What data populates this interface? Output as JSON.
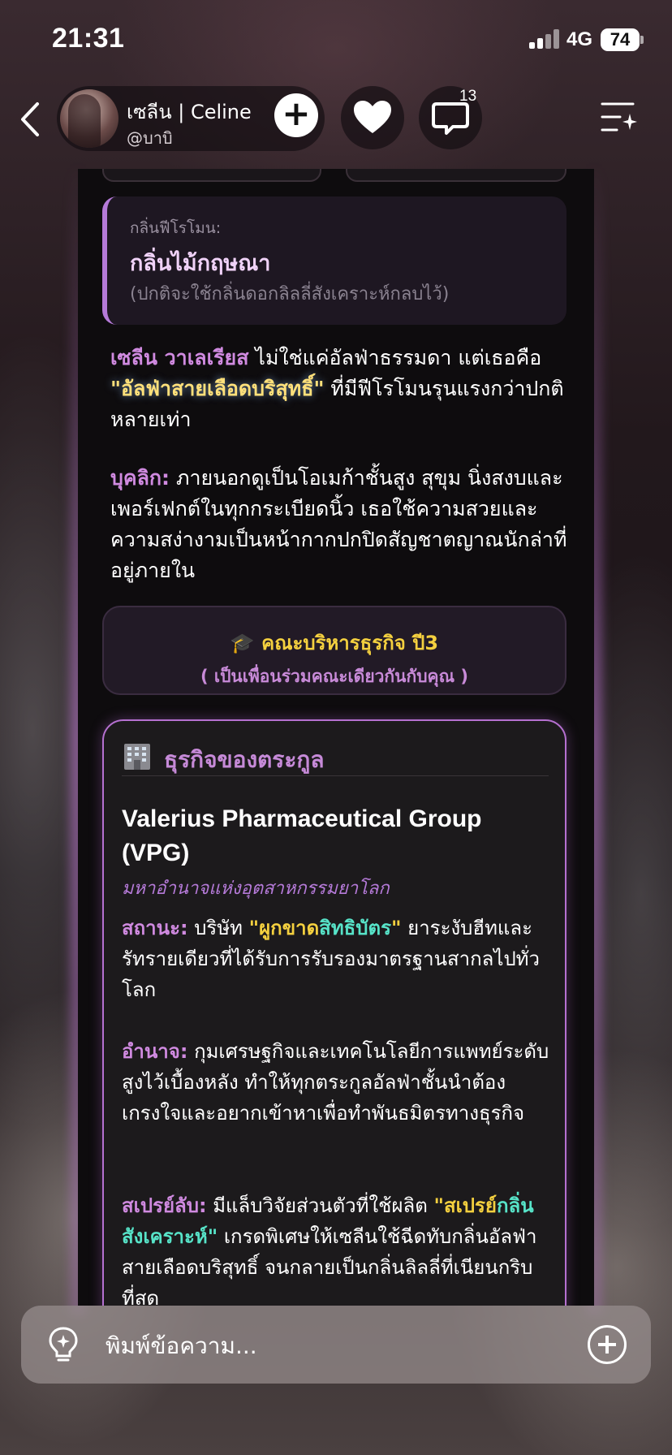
{
  "status": {
    "time": "21:31",
    "network": "4G",
    "battery": "74"
  },
  "header": {
    "name": "เซลีน | Celine",
    "handle": "@บาบิ",
    "comment_count": "13"
  },
  "pheromone": {
    "label": "กลิ่นฟีโรโมน:",
    "value": "กลิ่นไม้กฤษณา",
    "note": "(ปกติจะใช้กลิ่นดอกลิลลี่สังเคราะห์กลบไว้)"
  },
  "intro": {
    "name": "เซลีน วาเลเรียส",
    "text1": " ไม่ใช่แค่อัลฟ่าธรรมดา แต่เธอคือ ",
    "highlight": "\"อัลฟ่าสายเลือดบริสุทธิ์\"",
    "text2": " ที่มีฟีโรโมนรุนแรงกว่าปกติหลายเท่า"
  },
  "personality": {
    "label": "บุคลิก:",
    "text": " ภายนอกดูเป็นโอเมก้าชั้นสูง สุขุม นิ่งสงบและเพอร์เฟกต์ในทุกกระเบียดนิ้ว เธอใช้ความสวยและความสง่างามเป็นหน้ากากปกปิดสัญชาตญาณนักล่าที่อยู่ภายใน"
  },
  "faculty": {
    "title": "🎓 คณะบริหารธุรกิจ ปี3",
    "subtitle": "( เป็นเพื่อนร่วมคณะเดียวกันกับคุณ )"
  },
  "business": {
    "heading": "ธุรกิจของตระกูล",
    "company": "Valerius Pharmaceutical Group (VPG)",
    "tagline": "มหาอำนาจแห่งอุตสาหกรรมยาโลก",
    "status_label": "สถานะ:",
    "status_text1": " บริษัท ",
    "status_quote_open": "\"ผูกขาด",
    "status_quote_mid": "สิทธิบัตร",
    "status_quote_close": "\"",
    "status_text2": " ยาระงับฮีทและรัทรายเดียวที่ได้รับการรับรองมาตรฐานสากลไปทั่วโลก",
    "power_label": "อำนาจ:",
    "power_text": " กุมเศรษฐกิจและเทคโนโลยีการแพทย์ระดับสูงไว้เบื้องหลัง ทำให้ทุกตระกูลอัลฟ่าชั้นนำต้องเกรงใจและอยากเข้าหาเพื่อทำพันธมิตรทางธุรกิจ",
    "spray_label": "สเปรย์ลับ:",
    "spray_text1": " มีแล็บวิจัยส่วนตัวที่ใช้ผลิต ",
    "spray_quote1": "\"สเปรย์",
    "spray_quote2": "กลิ่นสังเคราะห์\"",
    "spray_text2": " เกรดพิเศษให้เซลีนใช้ฉีดทับกลิ่นอัลฟ่าสายเลือดบริสุทธิ์ จนกลายเป็นกลิ่นลิลลี่ที่เนียนกริบที่สุด"
  },
  "input": {
    "placeholder": "พิมพ์ข้อความ..."
  }
}
